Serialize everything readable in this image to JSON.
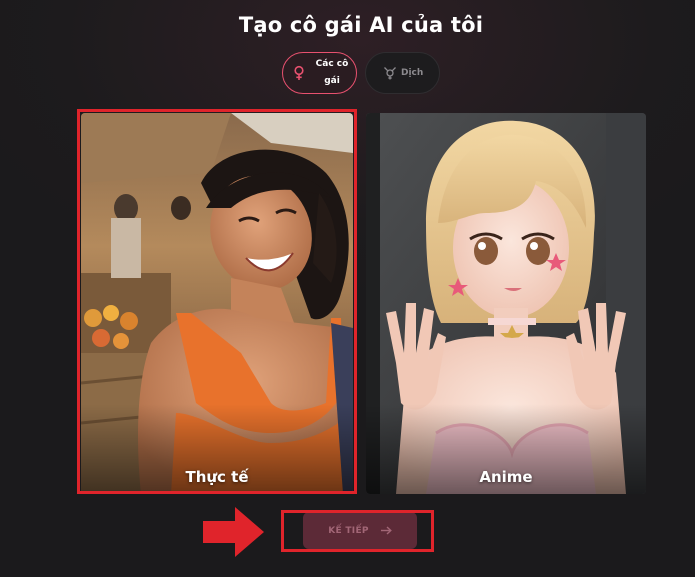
{
  "header": {
    "title": "Tạo cô gái AI của tôi"
  },
  "tabs": [
    {
      "label": "Các cô gái",
      "icon": "female-symbol-icon",
      "active": true
    },
    {
      "label": "Dịch",
      "icon": "transgender-symbol-icon",
      "active": false
    }
  ],
  "styles": [
    {
      "label": "Thực tế",
      "image": "realistic-woman-photo",
      "selected": true
    },
    {
      "label": "Anime",
      "image": "anime-girl-illustration",
      "selected": false
    }
  ],
  "next_button": {
    "label": "KẾ TIẾP",
    "icon": "arrow-right-icon",
    "enabled": false
  },
  "annotations": {
    "highlight_color": "#e0242b",
    "pointer_icon": "red-arrow-icon"
  },
  "colors": {
    "accent": "#e8516f",
    "background": "#1b1a1c",
    "button_disabled": "#5c2a37"
  }
}
